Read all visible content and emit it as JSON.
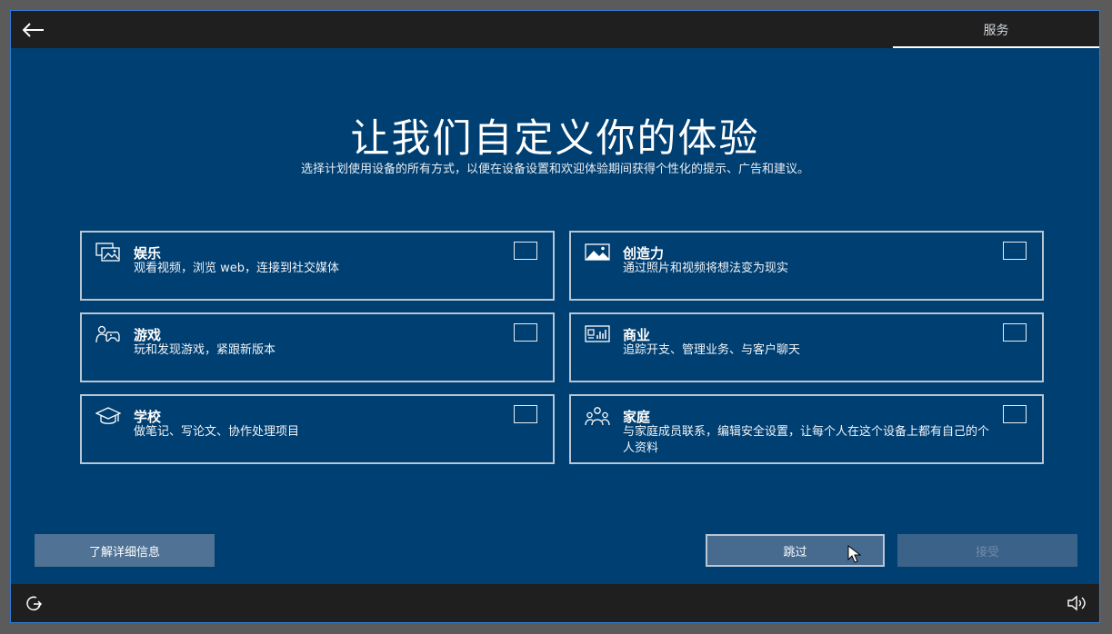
{
  "topbar": {
    "back_icon": "back-arrow-icon",
    "tab_label": "服务"
  },
  "header": {
    "title": "让我们自定义你的体验",
    "subtitle": "选择计划使用设备的所有方式，以便在设备设置和欢迎体验期间获得个性化的提示、广告和建议。"
  },
  "options": [
    {
      "title": "娱乐",
      "desc": "观看视频，浏览 web，连接到社交媒体",
      "icon": "entertainment-icon",
      "checked": false
    },
    {
      "title": "创造力",
      "desc": "通过照片和视频将想法变为现实",
      "icon": "creativity-icon",
      "checked": false
    },
    {
      "title": "游戏",
      "desc": "玩和发现游戏，紧跟新版本",
      "icon": "gaming-icon",
      "checked": false
    },
    {
      "title": "商业",
      "desc": "追踪开支、管理业务、与客户聊天",
      "icon": "business-icon",
      "checked": false
    },
    {
      "title": "学校",
      "desc": "做笔记、写论文、协作处理项目",
      "icon": "school-icon",
      "checked": false
    },
    {
      "title": "家庭",
      "desc": "与家庭成员联系，编辑安全设置，让每个人在这个设备上都有自己的个人资料",
      "icon": "family-icon",
      "checked": false
    }
  ],
  "buttons": {
    "learn_more": "了解详细信息",
    "skip": "跳过",
    "accept": "接受"
  },
  "bottombar": {
    "ease_icon": "ease-of-access-icon",
    "volume_icon": "volume-icon"
  },
  "colors": {
    "background": "#003f72",
    "bar": "#1f1f1f",
    "accent_border": "#2e7dd7"
  }
}
